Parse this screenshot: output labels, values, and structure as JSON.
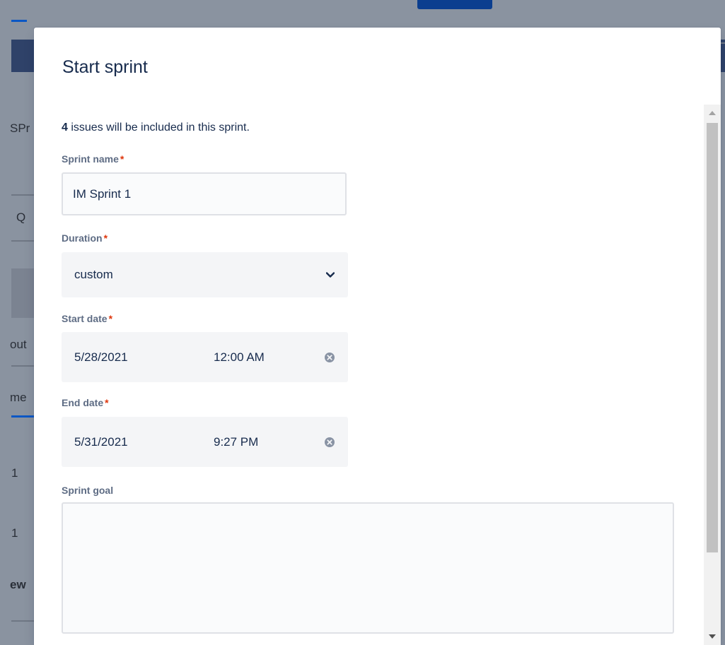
{
  "background": {
    "fragments": [
      "SPr",
      "Q",
      "out",
      "me",
      "1",
      "1",
      "ew"
    ]
  },
  "modal": {
    "title": "Start sprint",
    "info": {
      "count": "4",
      "text": " issues will be included in this sprint."
    },
    "sprint_name": {
      "label": "Sprint name",
      "required_mark": "*",
      "value": "IM Sprint 1"
    },
    "duration": {
      "label": "Duration",
      "required_mark": "*",
      "value": "custom"
    },
    "start_date": {
      "label": "Start date",
      "required_mark": "*",
      "date": "5/28/2021",
      "time": "12:00 AM"
    },
    "end_date": {
      "label": "End date",
      "required_mark": "*",
      "date": "5/31/2021",
      "time": "9:27 PM"
    },
    "sprint_goal": {
      "label": "Sprint goal",
      "value": ""
    }
  },
  "icons": {
    "duration_chevron": "chevron-down-icon",
    "start_clear": "clear-icon",
    "end_clear": "clear-icon",
    "scroll_up": "arrow-up-icon",
    "scroll_down": "arrow-down-icon"
  },
  "colors": {
    "title": "#172b4d",
    "label": "#5e6c84",
    "required": "#de350b",
    "field_bg": "#f4f5f7",
    "overlay": "#8a93a0"
  }
}
